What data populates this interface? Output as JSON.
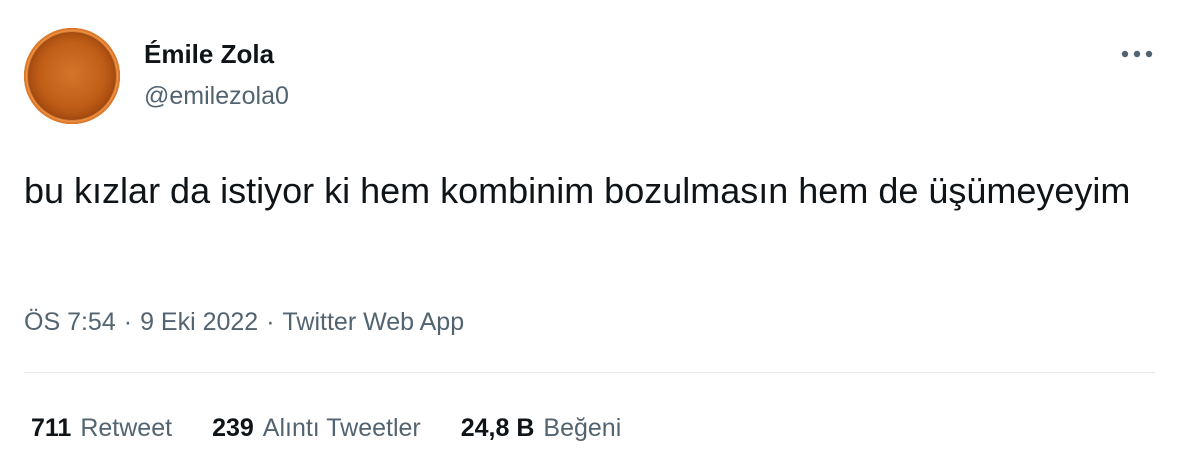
{
  "author": {
    "display_name": "Émile Zola",
    "handle": "@emilezola0",
    "avatar_colors": [
      "#d4752a",
      "#a84b10"
    ]
  },
  "more_icon": "more-horizontal-icon",
  "tweet": {
    "text": "bu kızlar da istiyor ki hem kombinim bozulmasın hem de üşümeyeyim"
  },
  "meta": {
    "time": "ÖS 7:54",
    "separator": "·",
    "date": "9 Eki 2022",
    "source": "Twitter Web App"
  },
  "stats": [
    {
      "count": "711",
      "label": "Retweet"
    },
    {
      "count": "239",
      "label": "Alıntı Tweetler"
    },
    {
      "count": "24,8 B",
      "label": "Beğeni"
    }
  ],
  "colors": {
    "primary_text": "#0f1419",
    "secondary_text": "#536471",
    "divider": "#e6e9eb"
  }
}
